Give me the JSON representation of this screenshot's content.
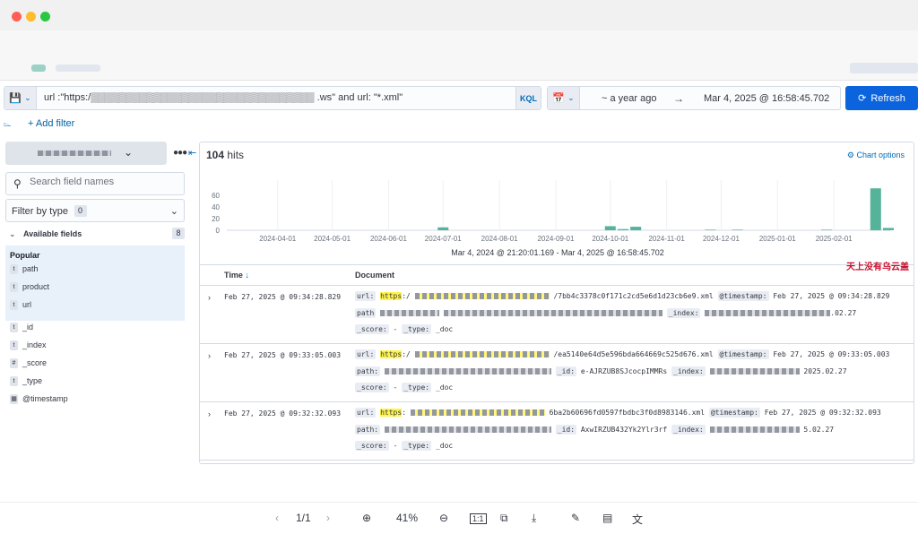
{
  "window": {
    "dot_colors": [
      "#ff5f57",
      "#febc2e",
      "#28c840"
    ]
  },
  "query": {
    "text": "url :\"https:/▒▒▒▒▒▒▒▒▒▒▒▒▒▒▒▒▒▒▒▒▒▒▒▒▒▒▒▒▒▒▒▒ .ws\" and url: \"*.xml\"",
    "language": "KQL"
  },
  "date": {
    "start": "~ a year ago",
    "end": "Mar 4, 2025 @ 16:58:45.702"
  },
  "refresh_label": "Refresh",
  "add_filter": "+ Add filter",
  "sidebar": {
    "search_placeholder": "Search field names",
    "filter_by_type": "Filter by type",
    "filter_count": "0",
    "available_fields": "Available fields",
    "available_count": "8",
    "popular_label": "Popular",
    "popular_fields": [
      {
        "type": "t",
        "name": "path"
      },
      {
        "type": "t",
        "name": "product"
      },
      {
        "type": "t",
        "name": "url"
      }
    ],
    "fields": [
      {
        "type": "t",
        "name": "_id"
      },
      {
        "type": "t",
        "name": "_index"
      },
      {
        "type": "#",
        "name": "_score"
      },
      {
        "type": "t",
        "name": "_type"
      },
      {
        "type": "cal",
        "name": "@timestamp"
      }
    ]
  },
  "results": {
    "hits_count": "104",
    "hits_label": "hits",
    "chart_options": "Chart options"
  },
  "chart_data": {
    "type": "bar",
    "x_ticks": [
      "2024-04-01",
      "2024-05-01",
      "2024-06-01",
      "2024-07-01",
      "2024-08-01",
      "2024-09-01",
      "2024-10-01",
      "2024-11-01",
      "2024-12-01",
      "2025-01-01",
      "2025-02-01"
    ],
    "y_ticks": [
      0,
      20,
      40,
      60
    ],
    "ylim": [
      0,
      80
    ],
    "bars": [
      {
        "date": "2024-07-01",
        "value": 5
      },
      {
        "date": "2024-10-01",
        "value": 7
      },
      {
        "date": "2024-10-08",
        "value": 2
      },
      {
        "date": "2024-10-15",
        "value": 6
      },
      {
        "date": "2024-11-25",
        "value": 1
      },
      {
        "date": "2024-12-10",
        "value": 1
      },
      {
        "date": "2025-01-28",
        "value": 1
      },
      {
        "date": "2025-02-24",
        "value": 72
      },
      {
        "date": "2025-03-03",
        "value": 4
      }
    ],
    "bar_color": "#54b399",
    "grid": true,
    "range_text": "Mar 4, 2024 @ 21:20:01.169 - Mar 4, 2025 @ 16:58:45.702"
  },
  "table": {
    "col_time": "Time",
    "col_doc": "Document",
    "rows": [
      {
        "time": "Feb 27, 2025 @ 09:34:28.829",
        "url_suffix": "/7bb4c3378c0f171c2cd5e6d1d23cb6e9.xml",
        "timestamp": "Feb 27, 2025 @ 09:34:28.829",
        "index_suffix": ".02.27",
        "score": "-",
        "type": "_doc"
      },
      {
        "time": "Feb 27, 2025 @ 09:33:05.003",
        "url_suffix": "/ea5140e64d5e596bda664669c525d676.xml",
        "timestamp": "Feb 27, 2025 @ 09:33:05.003",
        "id": "e-AJRZUB8SJcocpIMMRs",
        "index_suffix": "2025.02.27",
        "score": "-",
        "type": "_doc"
      },
      {
        "time": "Feb 27, 2025 @ 09:32:32.093",
        "url_suffix": "6ba2b60696fd0597fbdbc3f0d8983146.xml",
        "timestamp": "Feb 27, 2025 @ 09:32:32.093",
        "id": "AxwIRZUB432Yk2Ylr3rf",
        "index_suffix": "5.02.27",
        "score": "-",
        "type": "_doc"
      }
    ]
  },
  "watermark": "天上没有乌云盖",
  "viewer": {
    "page": "1/1",
    "zoom": "41%"
  }
}
